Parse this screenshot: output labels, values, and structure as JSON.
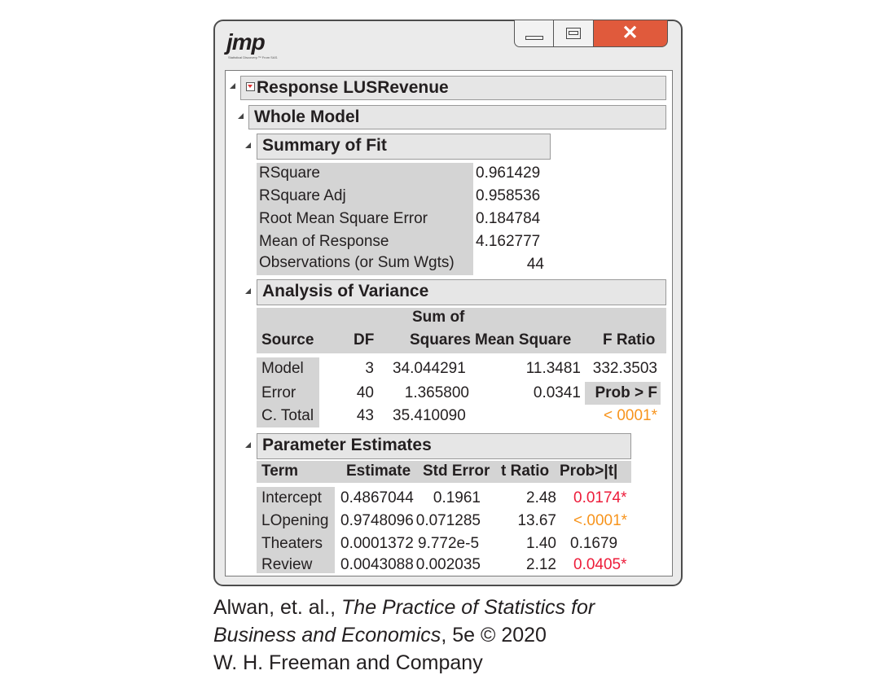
{
  "window": {
    "logo_text": "jmp",
    "logo_subtext": "Statistical Discovery.™ From SAS.",
    "buttons": [
      "minimize",
      "maximize",
      "close"
    ]
  },
  "response": {
    "title": "Response LUSRevenue",
    "whole_model": "Whole Model"
  },
  "summary_of_fit": {
    "title": "Summary of Fit",
    "rows": [
      {
        "label": "RSquare",
        "value": "0.961429"
      },
      {
        "label": "RSquare Adj",
        "value": "0.958536"
      },
      {
        "label": "Root Mean Square Error",
        "value": "0.184784"
      },
      {
        "label": "Mean of Response",
        "value": "4.162777"
      },
      {
        "label": "Observations (or Sum Wgts)",
        "value": "44"
      }
    ]
  },
  "anova": {
    "title": "Analysis of Variance",
    "headers": {
      "source": "Source",
      "df": "DF",
      "ss_top": "Sum of",
      "ss": "Squares",
      "ms": "Mean Square",
      "f": "F Ratio"
    },
    "rows": [
      {
        "source": "Model",
        "df": "3",
        "ss": "34.044291",
        "ms": "11.3481",
        "f": "332.3503"
      },
      {
        "source": "Error",
        "df": "40",
        "ss": "1.365800",
        "ms": "0.0341",
        "f": "Prob > F"
      },
      {
        "source": "C. Total",
        "df": "43",
        "ss": "35.410090",
        "ms": "",
        "f": "< 0001*"
      }
    ]
  },
  "parameter_estimates": {
    "title": "Parameter Estimates",
    "headers": {
      "term": "Term",
      "estimate": "Estimate",
      "se": "Std Error",
      "t": "t Ratio",
      "p": "Prob>|t|"
    },
    "rows": [
      {
        "term": "Intercept",
        "estimate": "0.4867044",
        "se": "0.1961",
        "t": "2.48",
        "p": "0.0174*",
        "p_color": "#ed1c3a"
      },
      {
        "term": "LOpening",
        "estimate": "0.9748096",
        "se": "0.071285",
        "t": "13.67",
        "p": "<.0001*",
        "p_color": "#f7941d"
      },
      {
        "term": "Theaters",
        "estimate": "0.0001372",
        "se": "9.772e-5",
        "t": "1.40",
        "p": "0.1679",
        "p_color": "#231f20"
      },
      {
        "term": "Review",
        "estimate": "0.0043088",
        "se": "0.002035",
        "t": "2.12",
        "p": "0.0405*",
        "p_color": "#ed1c3a"
      }
    ]
  },
  "caption": {
    "line1_pre": "Alwan, et. al., ",
    "line1_italic": "The Practice of Statistics for",
    "line2_italic": "Business and Economics",
    "line2_post": ", 5e © 2020",
    "line3": "W. H. Freeman and Company"
  }
}
